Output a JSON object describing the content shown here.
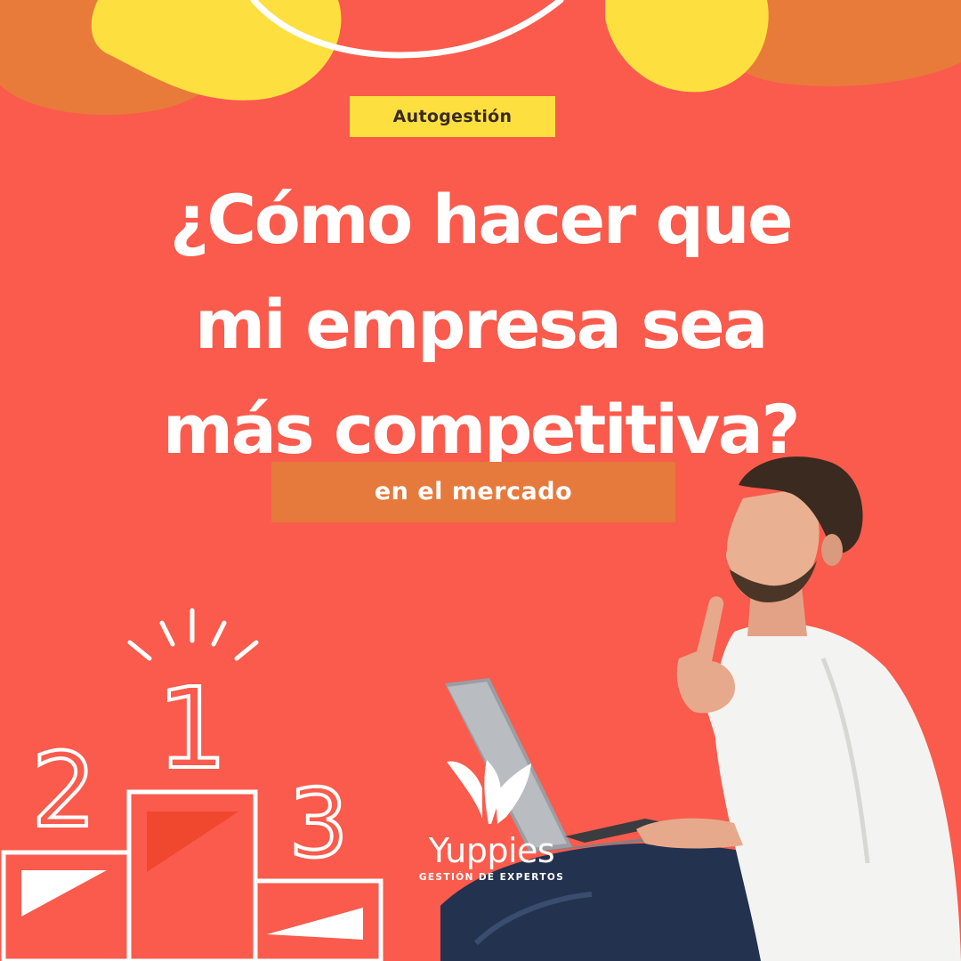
{
  "tag": "Autogestión",
  "headline": {
    "lines": [
      "¿Cómo hacer que",
      "mi empresa sea",
      "más competitiva?"
    ]
  },
  "subtag": "en el mercado",
  "podium": {
    "first": "1",
    "second": "2",
    "third": "3"
  },
  "logo": {
    "name": "Yuppies",
    "tagline": "GESTIÓN DE EXPERTOS"
  },
  "colors": {
    "background": "#fa5b4c",
    "yellow": "#fde040",
    "orange": "#e6793c",
    "text": "#ffffff"
  }
}
